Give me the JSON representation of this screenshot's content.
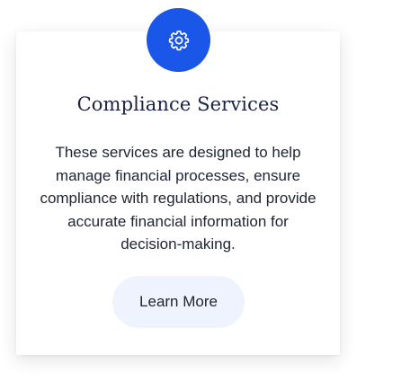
{
  "card": {
    "icon": "gear-icon",
    "title": "Compliance Services",
    "description": "These services are designed to help manage financial processes, ensure compliance with regulations, and provide accurate financial information for decision-making.",
    "button_label": "Learn More"
  },
  "colors": {
    "accent": "#1a56e8",
    "icon_fg": "#ffffff",
    "button_bg": "#eef3fd"
  }
}
